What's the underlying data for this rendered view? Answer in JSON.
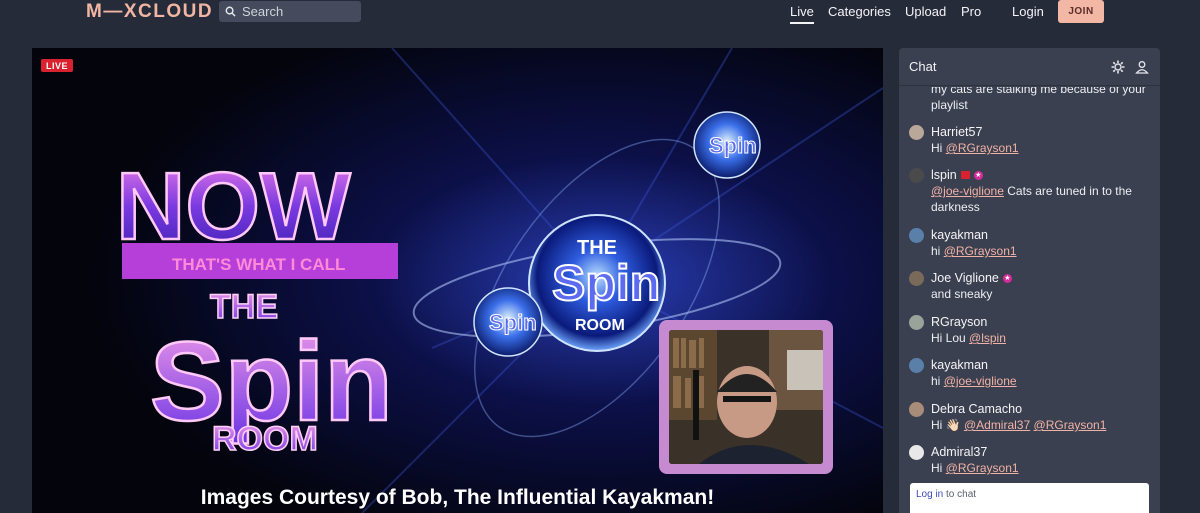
{
  "header": {
    "logo": "M—XCLOUD",
    "search_placeholder": "Search",
    "nav": {
      "live": "Live",
      "categories": "Categories",
      "upload": "Upload",
      "pro": "Pro",
      "login": "Login",
      "join": "JOIN"
    }
  },
  "player": {
    "live_badge": "LIVE",
    "art": {
      "now": "NOW",
      "thats": "THAT'S WHAT I CALL",
      "the": "THE",
      "spin": "Spin",
      "room": "ROOM",
      "orb_the": "THE",
      "orb_spin": "Spin",
      "orb_room": "ROOM"
    },
    "caption": "Images Courtesy of Bob, The Influential Kayakman!"
  },
  "chat": {
    "title": "Chat",
    "messages": [
      {
        "user": "",
        "text": "my cats are stalking me because of your playlist"
      },
      {
        "user": "Harriet57",
        "text": "Hi ",
        "mention": "@RGrayson1"
      },
      {
        "user": "lspin",
        "mention": "@joe-viglione",
        "text": " Cats are tuned in to the darkness"
      },
      {
        "user": "kayakman",
        "text": "hi ",
        "mention": "@RGrayson1"
      },
      {
        "user": "Joe Viglione",
        "text": "and sneaky"
      },
      {
        "user": "RGrayson",
        "text": "Hi Lou ",
        "mention": "@lspin"
      },
      {
        "user": "kayakman",
        "text": "hi ",
        "mention": "@joe-viglione"
      },
      {
        "user": "Debra Camacho",
        "text": "Hi 👋🏻 ",
        "mention": "@Admiral37",
        "mention2": "@RGrayson1"
      },
      {
        "user": "Admiral37",
        "text": "Hi ",
        "mention": "@RGrayson1"
      }
    ],
    "login_link": "Log in",
    "login_suffix": " to chat"
  },
  "colors": {
    "background": "#262b3a",
    "chat_panel": "#3b4050",
    "accent": "#f2b7a5",
    "mention": "#f0b2a6",
    "live_red": "#d8222f",
    "badge_pink": "#d52b9a"
  }
}
